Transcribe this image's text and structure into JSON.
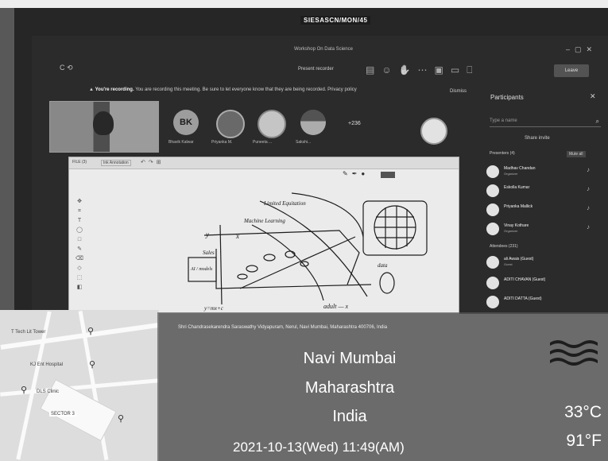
{
  "meeting": {
    "label": "SIESASCN/MON/45",
    "window_title": "Workshop On Data Science",
    "toolbar_center": "Present recorder",
    "leave_label": "Leave",
    "recording_banner_title": "You're recording.",
    "recording_banner_text": "You are recording this meeting. Be sure to let everyone know that they are being recorded. Privacy policy",
    "dismiss_label": "Dismiss"
  },
  "attendees_strip": {
    "avatars": [
      {
        "initials": "BK",
        "name": "Bhavik Kalwar"
      },
      {
        "initials": "",
        "name": "Priyanka M."
      },
      {
        "initials": "",
        "name": "Puneeta ..."
      },
      {
        "initials": "",
        "name": "Sakshi..."
      }
    ],
    "more_count": "+236"
  },
  "participants_panel": {
    "title": "Participants",
    "search_placeholder": "Type a name",
    "share_invite": "Share invite",
    "presenters_header": "Presenters (4)",
    "mute_all": "Mute all",
    "presenters": [
      {
        "name": "Madhav Chandan",
        "role": "Organizer"
      },
      {
        "name": "Eskolla Kumar",
        "role": ""
      },
      {
        "name": "Priyanka Mallick",
        "role": ""
      },
      {
        "name": "Vinay Kothare",
        "role": "Organizer"
      }
    ],
    "attendees_header": "Attendees (231)",
    "attendees": [
      {
        "name": "ali Awais (Guest)",
        "role": "Guest"
      },
      {
        "name": "ADITI CHAVAN (Guest)",
        "role": ""
      },
      {
        "name": "ADITI DATTA (Guest)",
        "role": ""
      }
    ]
  },
  "whiteboard": {
    "file_label": "FILE (3)",
    "layer_label": "Ink Annotation",
    "notes": {
      "label1": "Limited Equitation",
      "label2": "Machine Learning",
      "y_axis": "y",
      "sales": "Sales",
      "x_axis": "x",
      "boxed": "AI / models",
      "bottom_left": "y=mx+c",
      "bottom_right": "adult — x",
      "data": "data"
    }
  },
  "map": {
    "labels": [
      "T Tech Lit Tower",
      "KJ Ent Hospital",
      "DLS Clinic",
      "SECTOR 3"
    ]
  },
  "overlay": {
    "caption": "Shri Chandrasekarendra Saraswathy Vidyapuram, Nerul, Navi Mumbai, Maharashtra 400706, India",
    "city": "Navi Mumbai",
    "state": "Maharashtra",
    "country": "India",
    "temp_c": "33°C",
    "temp_f": "91°F",
    "datetime": "2021-10-13(Wed)  11:49(AM)"
  }
}
